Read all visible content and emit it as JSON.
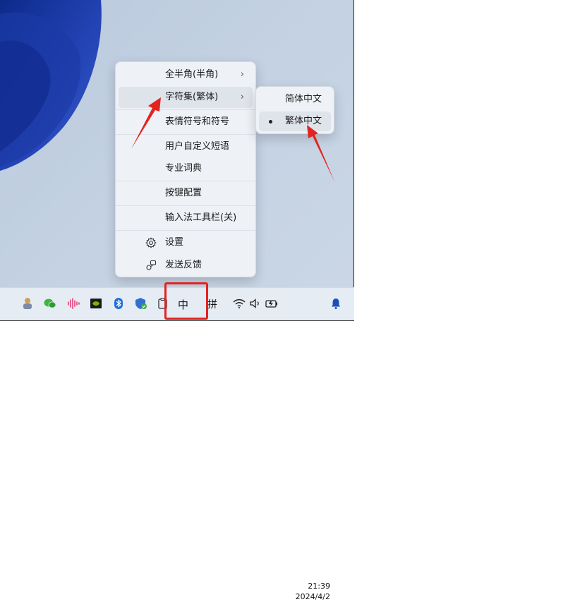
{
  "menu": {
    "items": [
      {
        "label": "全半角(半角)",
        "chevron": "›"
      },
      {
        "label": "字符集(繁体)",
        "chevron": "›"
      },
      {
        "label": "表情符号和符号",
        "chevron": ""
      },
      {
        "label": "用户自定义短语",
        "chevron": ""
      },
      {
        "label": "专业词典",
        "chevron": ""
      },
      {
        "label": "按键配置",
        "chevron": ""
      },
      {
        "label": "输入法工具栏(关)",
        "chevron": ""
      },
      {
        "label": "设置",
        "icon": "gear-icon"
      },
      {
        "label": "发送反馈",
        "icon": "feedback-icon"
      }
    ]
  },
  "submenu": {
    "items": [
      {
        "label": "简体中文",
        "selected": false
      },
      {
        "label": "繁体中文",
        "selected": true
      }
    ]
  },
  "taskbar": {
    "ime_mode": "中",
    "ime_pinyin": "拼",
    "time": "21:39",
    "date": "2024/4/2",
    "icons": [
      "people-icon",
      "wechat-icon",
      "audio-wave-icon",
      "nvidia-icon",
      "bluetooth-icon",
      "security-shield-icon",
      "clipboard-icon",
      "wifi-icon",
      "speaker-icon",
      "battery-icon",
      "notification-bell-icon"
    ]
  },
  "colors": {
    "accent_red": "#e3231f",
    "wallpaper_blue": "#1f3ea8"
  }
}
